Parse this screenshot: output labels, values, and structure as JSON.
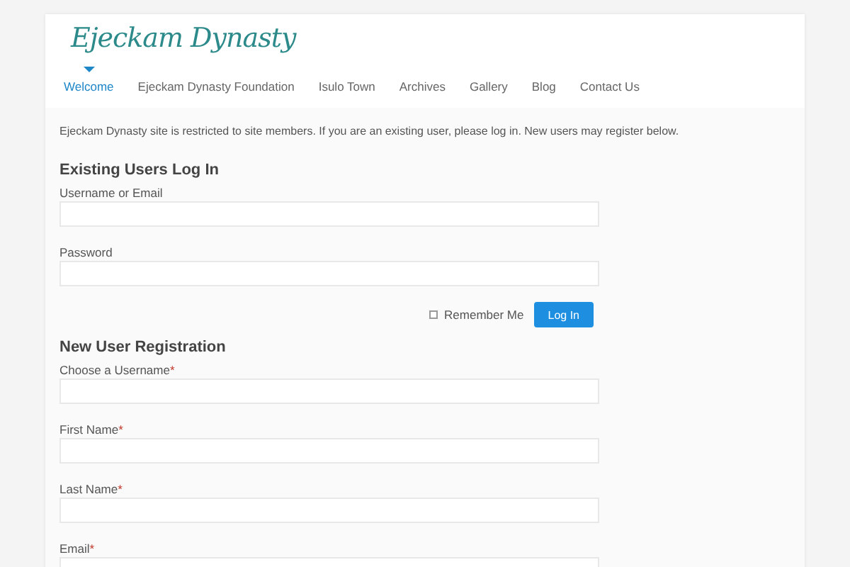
{
  "logo": "Ejeckam Dynasty",
  "nav": [
    {
      "label": "Welcome",
      "selected": true
    },
    {
      "label": "Ejeckam Dynasty Foundation",
      "selected": false
    },
    {
      "label": "Isulo Town",
      "selected": false
    },
    {
      "label": "Archives",
      "selected": false
    },
    {
      "label": "Gallery",
      "selected": false
    },
    {
      "label": "Blog",
      "selected": false
    },
    {
      "label": "Contact Us",
      "selected": false
    }
  ],
  "intro": "Ejeckam Dynasty site is restricted to site members. If you are an existing user, please log in. New users may register below.",
  "login": {
    "title": "Existing Users Log In",
    "fields": [
      {
        "label": "Username or Email"
      },
      {
        "label": "Password"
      }
    ],
    "remember_me": {
      "label": "Remember Me",
      "checked": false
    },
    "button": "Log In"
  },
  "register": {
    "title": "New User Registration",
    "fields": [
      {
        "label": "Choose a Username",
        "required_mark": "*"
      },
      {
        "label": "First Name",
        "required_mark": "*"
      },
      {
        "label": "Last Name",
        "required_mark": "*"
      },
      {
        "label": "Email",
        "required_mark": "*"
      }
    ]
  }
}
